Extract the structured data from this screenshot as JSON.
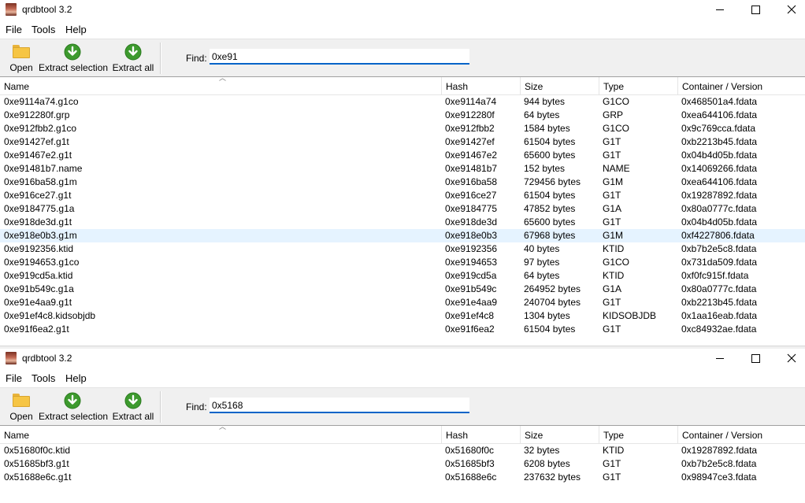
{
  "windows": [
    {
      "title": "qrdbtool 3.2",
      "menu": [
        "File",
        "Tools",
        "Help"
      ],
      "toolbar": {
        "open": "Open",
        "extract_selection": "Extract selection",
        "extract_all": "Extract all",
        "find_label": "Find:",
        "find_value": "0xe91"
      },
      "columns": [
        "Name",
        "Hash",
        "Size",
        "Type",
        "Container / Version"
      ],
      "selected_row": 10,
      "rows": [
        [
          "0xe9114a74.g1co",
          "0xe9114a74",
          "944 bytes",
          "G1CO",
          "0x468501a4.fdata"
        ],
        [
          "0xe912280f.grp",
          "0xe912280f",
          "64 bytes",
          "GRP",
          "0xea644106.fdata"
        ],
        [
          "0xe912fbb2.g1co",
          "0xe912fbb2",
          "1584 bytes",
          "G1CO",
          "0x9c769cca.fdata"
        ],
        [
          "0xe91427ef.g1t",
          "0xe91427ef",
          "61504 bytes",
          "G1T",
          "0xb2213b45.fdata"
        ],
        [
          "0xe91467e2.g1t",
          "0xe91467e2",
          "65600 bytes",
          "G1T",
          "0x04b4d05b.fdata"
        ],
        [
          "0xe91481b7.name",
          "0xe91481b7",
          "152 bytes",
          "NAME",
          "0x14069266.fdata"
        ],
        [
          "0xe916ba58.g1m",
          "0xe916ba58",
          "729456 bytes",
          "G1M",
          "0xea644106.fdata"
        ],
        [
          "0xe916ce27.g1t",
          "0xe916ce27",
          "61504 bytes",
          "G1T",
          "0x19287892.fdata"
        ],
        [
          "0xe9184775.g1a",
          "0xe9184775",
          "47852 bytes",
          "G1A",
          "0x80a0777c.fdata"
        ],
        [
          "0xe918de3d.g1t",
          "0xe918de3d",
          "65600 bytes",
          "G1T",
          "0x04b4d05b.fdata"
        ],
        [
          "0xe918e0b3.g1m",
          "0xe918e0b3",
          "67968 bytes",
          "G1M",
          "0xf4227806.fdata"
        ],
        [
          "0xe9192356.ktid",
          "0xe9192356",
          "40 bytes",
          "KTID",
          "0xb7b2e5c8.fdata"
        ],
        [
          "0xe9194653.g1co",
          "0xe9194653",
          "97 bytes",
          "G1CO",
          "0x731da509.fdata"
        ],
        [
          "0xe919cd5a.ktid",
          "0xe919cd5a",
          "64 bytes",
          "KTID",
          "0xf0fc915f.fdata"
        ],
        [
          "0xe91b549c.g1a",
          "0xe91b549c",
          "264952 bytes",
          "G1A",
          "0x80a0777c.fdata"
        ],
        [
          "0xe91e4aa9.g1t",
          "0xe91e4aa9",
          "240704 bytes",
          "G1T",
          "0xb2213b45.fdata"
        ],
        [
          "0xe91ef4c8.kidsobjdb",
          "0xe91ef4c8",
          "1304 bytes",
          "KIDSOBJDB",
          "0x1aa16eab.fdata"
        ],
        [
          "0xe91f6ea2.g1t",
          "0xe91f6ea2",
          "61504 bytes",
          "G1T",
          "0xc84932ae.fdata"
        ]
      ]
    },
    {
      "title": "qrdbtool 3.2",
      "menu": [
        "File",
        "Tools",
        "Help"
      ],
      "toolbar": {
        "open": "Open",
        "extract_selection": "Extract selection",
        "extract_all": "Extract all",
        "find_label": "Find:",
        "find_value": "0x5168"
      },
      "columns": [
        "Name",
        "Hash",
        "Size",
        "Type",
        "Container / Version"
      ],
      "selected_row": -1,
      "rows": [
        [
          "0x51680f0c.ktid",
          "0x51680f0c",
          "32 bytes",
          "KTID",
          "0x19287892.fdata"
        ],
        [
          "0x51685bf3.g1t",
          "0x51685bf3",
          "6208 bytes",
          "G1T",
          "0xb7b2e5c8.fdata"
        ],
        [
          "0x51688e6c.g1t",
          "0x51688e6c",
          "237632 bytes",
          "G1T",
          "0x98947ce3.fdata"
        ]
      ]
    }
  ]
}
